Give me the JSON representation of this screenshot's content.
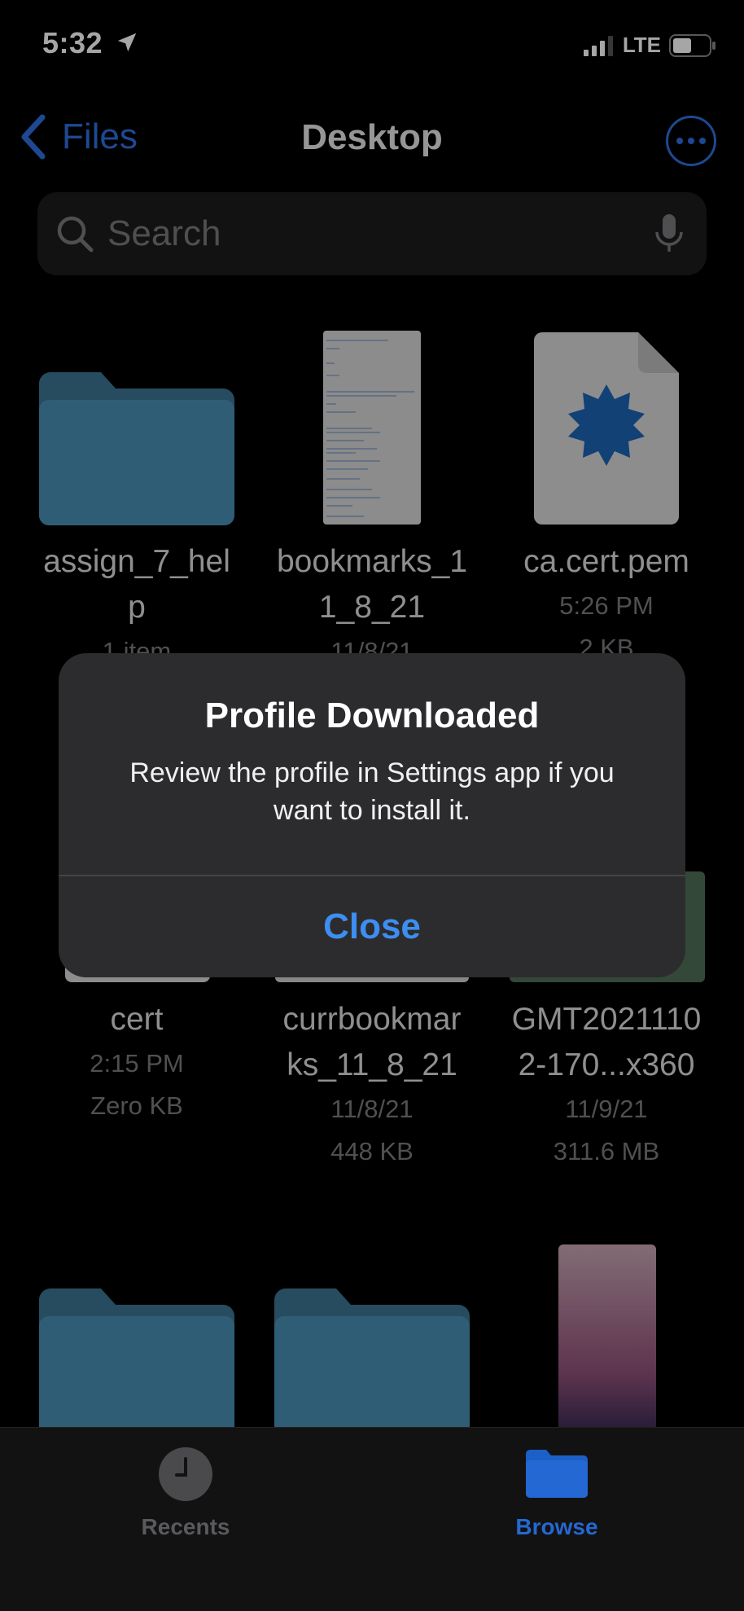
{
  "status": {
    "time": "5:32",
    "network": "LTE"
  },
  "nav": {
    "back_label": "Files",
    "title": "Desktop"
  },
  "search": {
    "placeholder": "Search"
  },
  "files": [
    {
      "name_line1": "assign_7_hel",
      "name_line2": "p",
      "meta1": "1 item",
      "meta2": "",
      "type": "folder"
    },
    {
      "name_line1": "bookmarks_1",
      "name_line2": "1_8_21",
      "meta1": "11/8/21",
      "meta2": "",
      "type": "document"
    },
    {
      "name_line1": "ca.cert.pem",
      "name_line2": "",
      "meta1": "5:26 PM",
      "meta2": "2 KB",
      "type": "certificate"
    },
    {
      "name_line1": "cert",
      "name_line2": "",
      "meta1": "2:15 PM",
      "meta2": "Zero KB",
      "type": "file"
    },
    {
      "name_line1": "currbookmar",
      "name_line2": "ks_11_8_21",
      "meta1": "11/8/21",
      "meta2": "448 KB",
      "type": "document"
    },
    {
      "name_line1": "GMT2021110",
      "name_line2": "2-170...x360",
      "meta1": "11/9/21",
      "meta2": "311.6 MB",
      "type": "video"
    }
  ],
  "alert": {
    "title": "Profile Downloaded",
    "message": "Review the profile in Settings app if you want to install it.",
    "button": "Close"
  },
  "tabs": [
    {
      "label": "Recents",
      "icon": "clock-icon",
      "active": false
    },
    {
      "label": "Browse",
      "icon": "folder-icon",
      "active": true
    }
  ],
  "colors": {
    "accent": "#2f6fe0",
    "alert_button": "#3d8ef0",
    "folder": "#4a8fb5"
  }
}
